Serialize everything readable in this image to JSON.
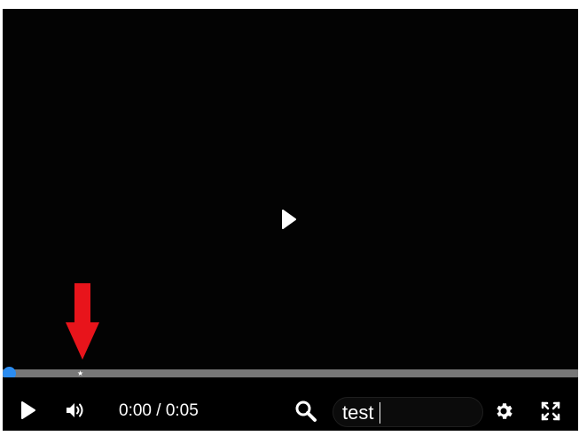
{
  "player": {
    "time_display": "0:00 / 0:05",
    "progress_fraction": 0.0,
    "colors": {
      "progress_knob": "#2b8cf0",
      "progress_track": "#777777",
      "annotation_arrow": "#e8141b"
    }
  },
  "controls": {
    "play_icon": "play-icon",
    "volume_icon": "volume-icon",
    "search_icon": "search-icon",
    "settings_icon": "gear-icon",
    "fullscreen_icon": "fullscreen-icon"
  },
  "search": {
    "value": "test",
    "placeholder": ""
  }
}
